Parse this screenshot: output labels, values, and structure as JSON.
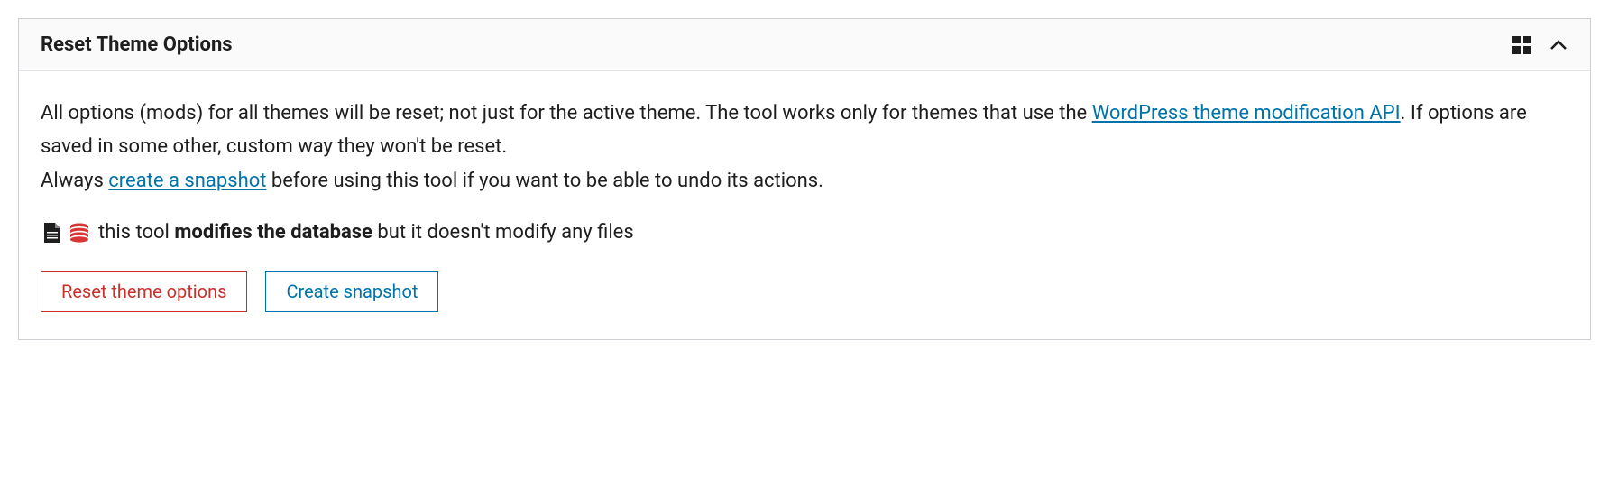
{
  "panel": {
    "title": "Reset Theme Options",
    "description": {
      "text1": "All options (mods) for all themes will be reset; not just for the active theme. The tool works only for themes that use the ",
      "link1": "WordPress theme modification API",
      "text2": ". If options are saved in some other, custom way they won't be reset.",
      "text3": "Always ",
      "link2": "create a snapshot",
      "text4": " before using this tool if you want to be able to undo its actions."
    },
    "info": {
      "text1": "this tool ",
      "strong1": "modifies the database",
      "text2": " but it doesn't modify any files"
    },
    "buttons": {
      "reset": "Reset theme options",
      "snapshot": "Create snapshot"
    }
  }
}
